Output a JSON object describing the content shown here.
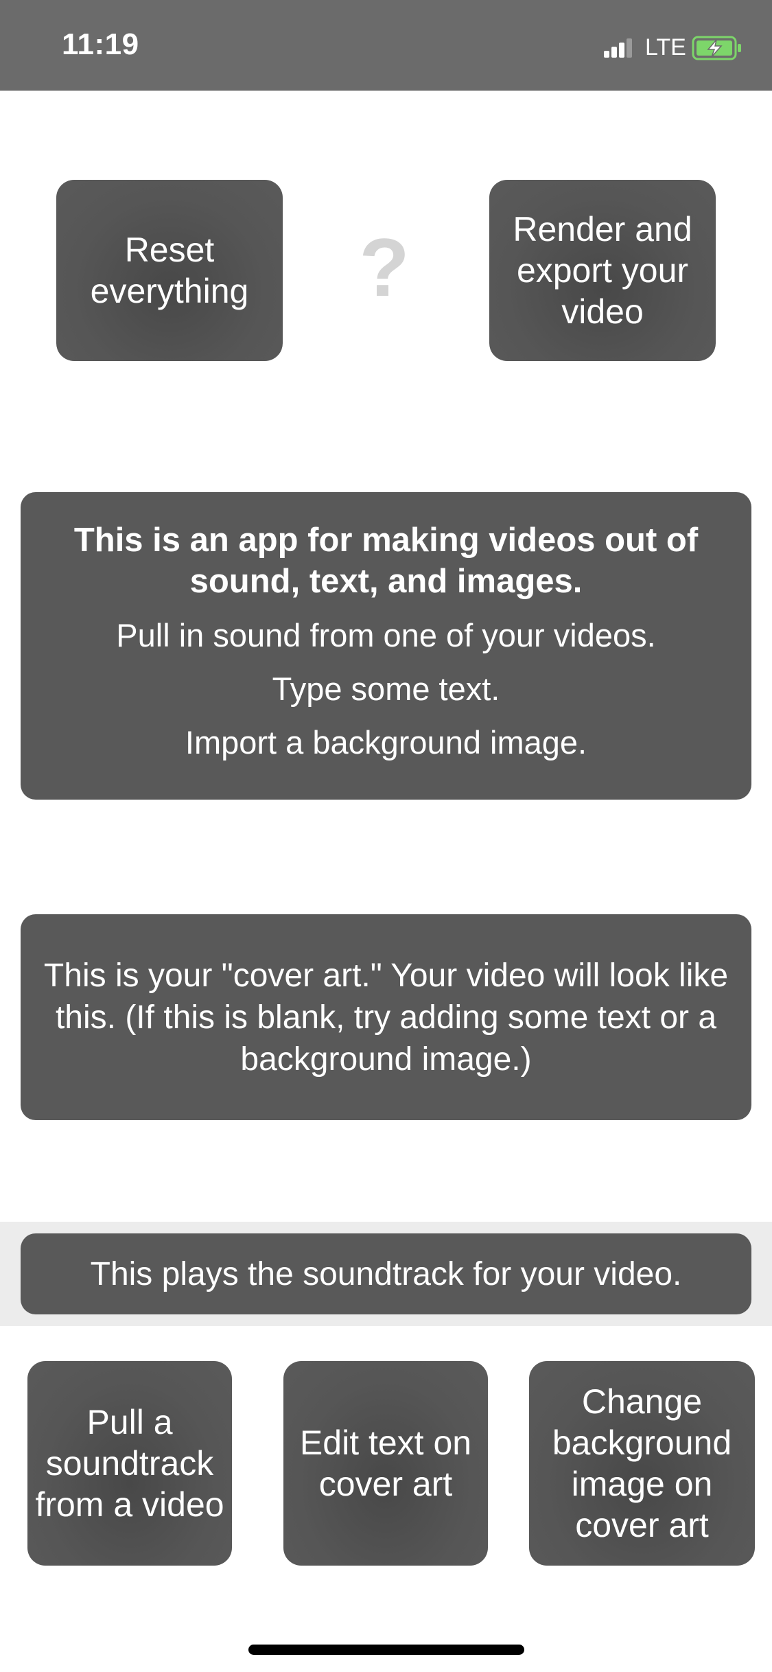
{
  "status_bar": {
    "time": "11:19",
    "network": "LTE",
    "signal_icon": "signal-bars-icon",
    "battery_icon": "battery-charging-icon",
    "battery_color": "#7dd66a"
  },
  "toolbar": {
    "reset_label": "Reset everything",
    "help_label": "?",
    "render_label": "Render and export your video"
  },
  "intro": {
    "title": "This is an app for making videos out of sound, text, and images.",
    "lines": [
      "Pull in sound from one of your videos.",
      "Type some text.",
      "Import a background image."
    ]
  },
  "cover_art": {
    "text": "This is your \"cover art.\" Your video will look like this. (If this is blank, try adding some text or a background image.)"
  },
  "soundtrack": {
    "text": "This plays the soundtrack for your video."
  },
  "actions": {
    "pull_label": "Pull a soundtrack from a video",
    "edit_text_label": "Edit text on cover art",
    "background_label": "Change background image on cover art"
  },
  "colors": {
    "button_bg": "#575757",
    "status_bar_bg": "#6b6b6b",
    "help_icon": "#d4d4d4"
  }
}
